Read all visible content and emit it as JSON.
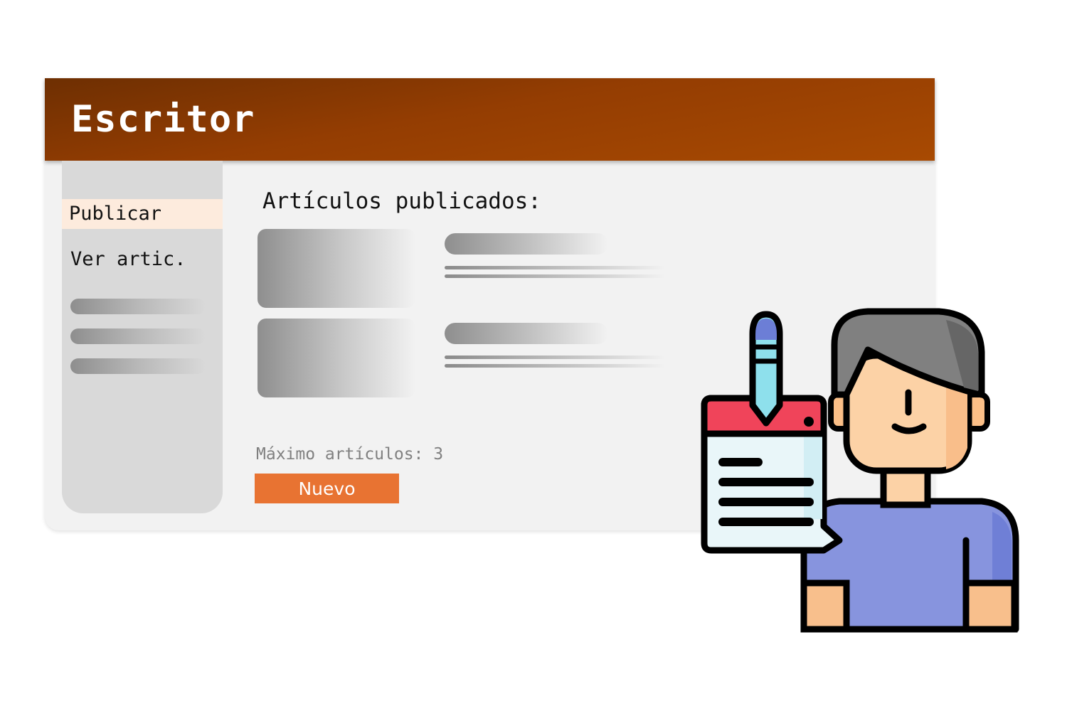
{
  "app": {
    "title": "Escritor"
  },
  "sidebar": {
    "items": [
      {
        "label": "Publicar",
        "active": true
      },
      {
        "label": "Ver artic.",
        "active": false
      }
    ]
  },
  "main": {
    "section_title": "Artículos publicados:",
    "limit_text": "Máximo artículos: 3",
    "new_button_label": "Nuevo"
  },
  "colors": {
    "header": "#a84a02",
    "active_nav": "#fdebdd",
    "button": "#e87332",
    "sidebar": "#d9d9d9",
    "panel": "#f2f2f2"
  },
  "illustration": {
    "icon": "writer-with-document-and-pen-icon"
  }
}
